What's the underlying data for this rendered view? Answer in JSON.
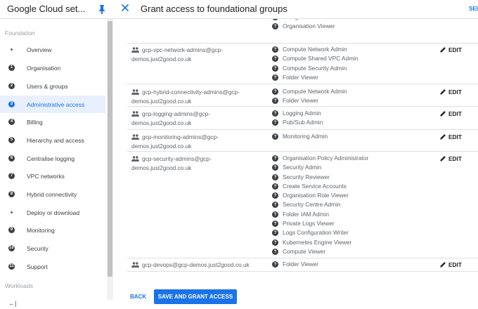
{
  "sidebar": {
    "title": "Google Cloud set...",
    "section_foundation": "Foundation",
    "section_workloads": "Workloads",
    "collapse_icon": "←|",
    "items": [
      {
        "num": "",
        "label": "Overview"
      },
      {
        "num": "1",
        "label": "Organisation"
      },
      {
        "num": "2",
        "label": "Users & groups"
      },
      {
        "num": "3",
        "label": "Administrative access",
        "active": true
      },
      {
        "num": "4",
        "label": "Billing"
      },
      {
        "num": "5",
        "label": "Hierarchy and access"
      },
      {
        "num": "6",
        "label": "Centralise logging"
      },
      {
        "num": "7",
        "label": "VPC networks"
      },
      {
        "num": "8",
        "label": "Hybrid connectivity"
      },
      {
        "num": "",
        "label": "Deploy or download"
      },
      {
        "num": "9",
        "label": "Monitoring"
      },
      {
        "num": "10",
        "label": "Security"
      },
      {
        "num": "11",
        "label": "Support"
      }
    ]
  },
  "panel": {
    "title": "Grant access to foundational groups",
    "send_partial": "SEI",
    "edit_label": "EDIT",
    "help_glyph": "?",
    "rows": [
      {
        "group": "",
        "roles": [
          "Billing Account Creator",
          "Organisation Viewer"
        ]
      },
      {
        "group": "gcp-vpc-network-admins@gcp-demos.just2good.co.uk",
        "roles": [
          "Compute Network Admin",
          "Compute Shared VPC Admin",
          "Compute Security Admin",
          "Folder Viewer"
        ]
      },
      {
        "group": "gcp-hybrid-connectivity-admins@gcp-demos.just2good.co.uk",
        "roles": [
          "Compute Network Admin",
          "Folder Viewer"
        ]
      },
      {
        "group": "gcp-logging-admins@gcp-demos.just2good.co.uk",
        "roles": [
          "Logging Admin",
          "Pub/Sub Admin"
        ]
      },
      {
        "group": "gcp-monitoring-admins@gcp-demos.just2good.co.uk",
        "roles": [
          "Monitoring Admin"
        ]
      },
      {
        "group": "gcp-security-admins@gcp-demos.just2good.co.uk",
        "roles": [
          "Organisation Policy Administrator",
          "Security Admin",
          "Security Reviewer",
          "Create Service Accounts",
          "Organisation Role Viewer",
          "Security Centre Admin",
          "Folder IAM Admin",
          "Private Logs Viewer",
          "Logs Configuration Writer",
          "Kubernetes Engine Viewer",
          "Compute Viewer"
        ]
      },
      {
        "group": "gcp-devops@gcp-demos.just2good.co.uk",
        "roles": [
          "Folder Viewer"
        ]
      }
    ]
  },
  "actions": {
    "back": "BACK",
    "save": "SAVE AND GRANT ACCESS"
  },
  "colors": {
    "accent": "#1a73e8",
    "active_bg": "#e8f0fe"
  }
}
